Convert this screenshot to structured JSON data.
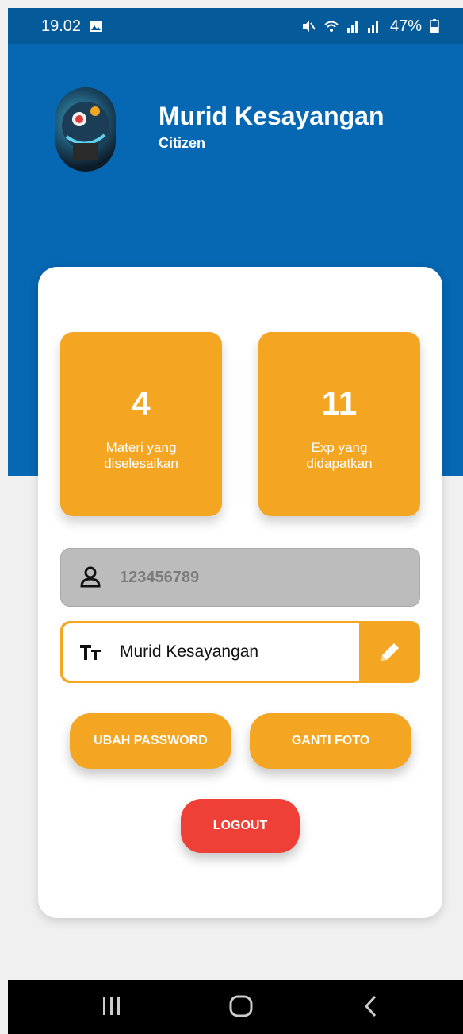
{
  "status_bar": {
    "time": "19.02",
    "battery": "47%"
  },
  "profile": {
    "name": "Murid Kesayangan",
    "role": "Citizen"
  },
  "stats": [
    {
      "value": "4",
      "label_line1": "Materi yang",
      "label_line2": "diselesaikan"
    },
    {
      "value": "11",
      "label_line1": "Exp yang",
      "label_line2": "didapatkan"
    }
  ],
  "fields": {
    "user_id": "123456789",
    "display_name": "Murid Kesayangan"
  },
  "buttons": {
    "change_password": "UBAH PASSWORD",
    "change_photo": "GANTI FOTO",
    "logout": "LOGOUT"
  },
  "colors": {
    "header_blue": "#0667b2",
    "accent_orange": "#f4a623",
    "logout_red": "#ee4036"
  }
}
